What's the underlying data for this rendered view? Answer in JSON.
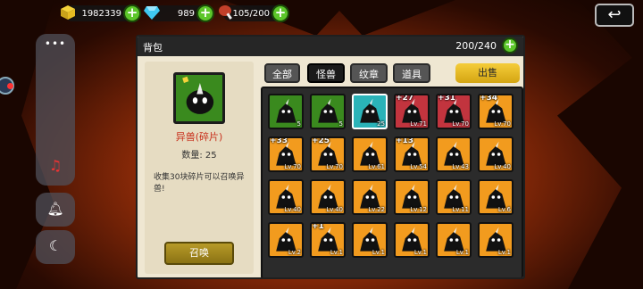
{
  "resources": {
    "gold": "1982339",
    "gems": "989",
    "meat": "105/200"
  },
  "panel": {
    "title": "背包",
    "capacity": "200/240"
  },
  "tabs": [
    {
      "label": "全部"
    },
    {
      "label": "怪兽"
    },
    {
      "label": "纹章"
    },
    {
      "label": "道具"
    }
  ],
  "active_tab": "怪兽",
  "sell_label": "出售",
  "selected": {
    "name": "异兽(碎片)",
    "quantity": "数量: 25",
    "description": "收集30块碎片可以召唤异兽!",
    "summon_label": "召唤"
  },
  "items": [
    {
      "label": "5",
      "bg": "#3a8a1e"
    },
    {
      "label": "5",
      "bg": "#3a8a1e"
    },
    {
      "label": "25",
      "bg": "#2ab3b8"
    },
    {
      "star": "+27",
      "label": "Lv.71",
      "bg": "#c2343e"
    },
    {
      "star": "+31",
      "label": "Lv.70",
      "bg": "#c2343e"
    },
    {
      "star": "+34",
      "label": "Lv.70",
      "bg": "#f29b1e"
    },
    {
      "star": "+33",
      "label": "Lv.70",
      "bg": "#f29b1e"
    },
    {
      "star": "+25",
      "label": "Lv.70",
      "bg": "#f29b1e"
    },
    {
      "label": "Lv.61",
      "bg": "#f29b1e"
    },
    {
      "star": "+13",
      "label": "Lv.54",
      "bg": "#f29b1e"
    },
    {
      "label": "Lv.43",
      "bg": "#f29b1e"
    },
    {
      "label": "Lv.40",
      "bg": "#f29b1e"
    },
    {
      "label": "Lv.40",
      "bg": "#f29b1e"
    },
    {
      "label": "Lv.40",
      "bg": "#f29b1e"
    },
    {
      "label": "Lv.22",
      "bg": "#f29b1e"
    },
    {
      "label": "Lv.12",
      "bg": "#f29b1e"
    },
    {
      "label": "Lv.11",
      "bg": "#f29b1e"
    },
    {
      "label": "Lv.6",
      "bg": "#f29b1e"
    },
    {
      "label": "Lv.2",
      "bg": "#f29b1e"
    },
    {
      "star": "+1",
      "label": "Lv.1",
      "bg": "#f29b1e"
    },
    {
      "label": "Lv.1",
      "bg": "#f29b1e"
    },
    {
      "label": "Lv.1",
      "bg": "#f29b1e"
    },
    {
      "label": "Lv.1",
      "bg": "#f29b1e"
    },
    {
      "label": "Lv.1",
      "bg": "#f29b1e"
    }
  ]
}
